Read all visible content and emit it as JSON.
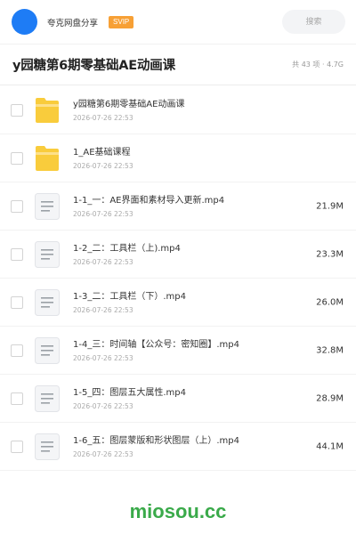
{
  "header": {
    "share_name": "夸克网盘分享",
    "badge": "SVIP",
    "search_placeholder": "搜索",
    "avatar_color": "#1e7cf5",
    "badge_color": "#f7a035"
  },
  "folder": {
    "title": "y园糖第6期零基础AE动画课",
    "summary": "共 43 项 · 4.7G"
  },
  "items": [
    {
      "type": "folder",
      "icon": "folder-icon",
      "name": "y园糖第6期零基础AE动画课",
      "date": "2026-07-26 22:53",
      "size": ""
    },
    {
      "type": "folder",
      "icon": "folder-icon",
      "name": "1_AE基础课程",
      "date": "2026-07-26 22:53",
      "size": ""
    },
    {
      "type": "file",
      "icon": "file-icon",
      "name": "1-1_一：AE界面和素材导入更新.mp4",
      "date": "2026-07-26 22:53",
      "size": "21.9M"
    },
    {
      "type": "file",
      "icon": "file-icon",
      "name": "1-2_二：工具栏（上).mp4",
      "date": "2026-07-26 22:53",
      "size": "23.3M"
    },
    {
      "type": "file",
      "icon": "file-icon",
      "name": "1-3_二：工具栏（下）.mp4",
      "date": "2026-07-26 22:53",
      "size": "26.0M"
    },
    {
      "type": "file",
      "icon": "file-icon",
      "name": "1-4_三：时间轴【公众号：密知圈】.mp4",
      "date": "2026-07-26 22:53",
      "size": "32.8M"
    },
    {
      "type": "file",
      "icon": "file-icon",
      "name": "1-5_四：图层五大属性.mp4",
      "date": "2026-07-26 22:53",
      "size": "28.9M"
    },
    {
      "type": "file",
      "icon": "file-icon",
      "name": "1-6_五：图层蒙版和形状图层（上）.mp4",
      "date": "2026-07-26 22:53",
      "size": "44.1M"
    }
  ],
  "watermark": "miosou.cc",
  "colors": {
    "folder_yellow": "#f9cc3c",
    "watermark_green": "#3aaa4a"
  }
}
